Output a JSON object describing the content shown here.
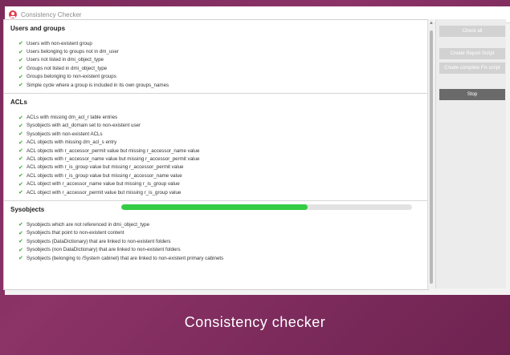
{
  "window": {
    "title": "Consistency Checker"
  },
  "sections": [
    {
      "title": "Users and groups",
      "items": [
        "Users with non-existent group",
        "Users belonging to groups not in dm_user",
        "Users not listed in dmi_object_type",
        "Groups not listed in dmi_object_type",
        "Groups belonging to non-existent groups",
        "Simple cycle where a group is included in its own groups_names"
      ]
    },
    {
      "title": "ACLs",
      "items": [
        "ACLs with missing dm_acl_r table entries",
        "Sysobjects with acl_domain set to non-existent user",
        "Sysobjects with non-existent ACLs",
        "ACL objects with missing dm_acl_s entry",
        "ACL objects with r_accessor_permit value but missing r_accessor_name value",
        "ACL objects with r_accessor_name value but missing r_accessor_permit value",
        "ACL objects with r_is_group value but missing r_accessor_permit value",
        "ACL objects with r_is_group value but missing r_accessor_name value",
        "ACL object with r_accessor_name value but missing r_is_group value",
        "ACL object with r_accessor_permit value but missing r_is_group value"
      ]
    },
    {
      "title": "Sysobjects",
      "progress": 0.64,
      "items": [
        "Sysobjects which are not referenced in dmi_object_type",
        "Sysobjects that point to non-existent content",
        "Sysobjects (DataDictionary) that are linked to non-existent folders",
        "Sysobjects (non DataDictionary) that are linked to non-existent folders",
        "Sysobjects (belonging to /System cabinet) that are linked to non-existent primary cabinets"
      ]
    }
  ],
  "buttons": {
    "check_all": "Check all",
    "create_report": "Create Report Script",
    "create_complete": "Create complete Fix script",
    "stop": "Stop"
  },
  "caption": "Consistency checker",
  "colors": {
    "frame": "#8c3368",
    "progress": "#33cc44",
    "check": "#3aa53a",
    "stop_button": "#6a6a6a"
  },
  "icons": {
    "app": "app-logo-icon",
    "check": "checkmark-icon"
  }
}
